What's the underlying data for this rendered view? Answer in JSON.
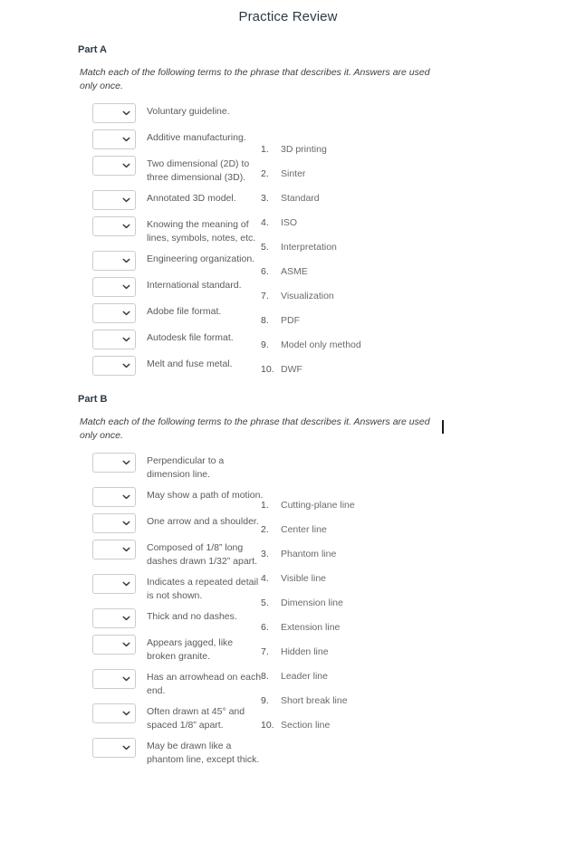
{
  "document": {
    "title": "Practice Review"
  },
  "colors": {
    "title_text": "#2d3b45",
    "body_text": "#5b5b5b",
    "answer_text": "#6a6a6a",
    "select_border": "#c7cdd1",
    "page_background": "#ffffff",
    "caret": "#1a1a1a"
  },
  "icons": {
    "chevron_down": "chevron-down-icon"
  },
  "parts": [
    {
      "heading": "Part A",
      "instructions": "Match each of the following terms to the phrase that describes it. Answers are used only once.",
      "terms": [
        {
          "text": "Voluntary guideline.",
          "selected": ""
        },
        {
          "text": "Additive manufacturing.",
          "selected": ""
        },
        {
          "text": "Two dimensional (2D) to three dimensional (3D).",
          "selected": ""
        },
        {
          "text": "Annotated 3D model.",
          "selected": ""
        },
        {
          "text": "Knowing the meaning of lines, symbols, notes, etc.",
          "selected": ""
        },
        {
          "text": "Engineering organization.",
          "selected": ""
        },
        {
          "text": "International standard.",
          "selected": ""
        },
        {
          "text": "Adobe file format.",
          "selected": ""
        },
        {
          "text": "Autodesk file format.",
          "selected": ""
        },
        {
          "text": "Melt and fuse metal.",
          "selected": ""
        }
      ],
      "answers": [
        {
          "number": "1.",
          "label": "3D printing"
        },
        {
          "number": "2.",
          "label": "Sinter"
        },
        {
          "number": "3.",
          "label": "Standard"
        },
        {
          "number": "4.",
          "label": "ISO"
        },
        {
          "number": "5.",
          "label": "Interpretation"
        },
        {
          "number": "6.",
          "label": "ASME"
        },
        {
          "number": "7.",
          "label": "Visualization"
        },
        {
          "number": "8.",
          "label": "PDF"
        },
        {
          "number": "9.",
          "label": "Model only method"
        },
        {
          "number": "10.",
          "label": "DWF"
        }
      ]
    },
    {
      "heading": "Part B",
      "instructions": "Match each of the following terms to the phrase that describes it. Answers are used only once.",
      "terms": [
        {
          "text": "Perpendicular to a dimension line.",
          "selected": ""
        },
        {
          "text": "May show a path of motion.",
          "selected": ""
        },
        {
          "text": "One arrow and a shoulder.",
          "selected": ""
        },
        {
          "text": "Composed of 1/8” long dashes drawn 1/32” apart.",
          "selected": ""
        },
        {
          "text": "Indicates a repeated detail is not shown.",
          "selected": ""
        },
        {
          "text": "Thick and no dashes.",
          "selected": ""
        },
        {
          "text": "Appears jagged, like broken granite.",
          "selected": ""
        },
        {
          "text": "Has an arrowhead on each end.",
          "selected": ""
        },
        {
          "text": "Often drawn at 45° and spaced 1/8” apart.",
          "selected": ""
        },
        {
          "text": "May be drawn like a phantom line, except thick.",
          "selected": ""
        }
      ],
      "answers": [
        {
          "number": "1.",
          "label": "Cutting-plane line"
        },
        {
          "number": "2.",
          "label": "Center line"
        },
        {
          "number": "3.",
          "label": "Phantom line"
        },
        {
          "number": "4.",
          "label": "Visible line"
        },
        {
          "number": "5.",
          "label": "Dimension line"
        },
        {
          "number": "6.",
          "label": "Extension line"
        },
        {
          "number": "7.",
          "label": "Hidden line"
        },
        {
          "number": "8.",
          "label": "Leader line"
        },
        {
          "number": "9.",
          "label": "Short break line"
        },
        {
          "number": "10.",
          "label": "Section line"
        }
      ]
    }
  ]
}
